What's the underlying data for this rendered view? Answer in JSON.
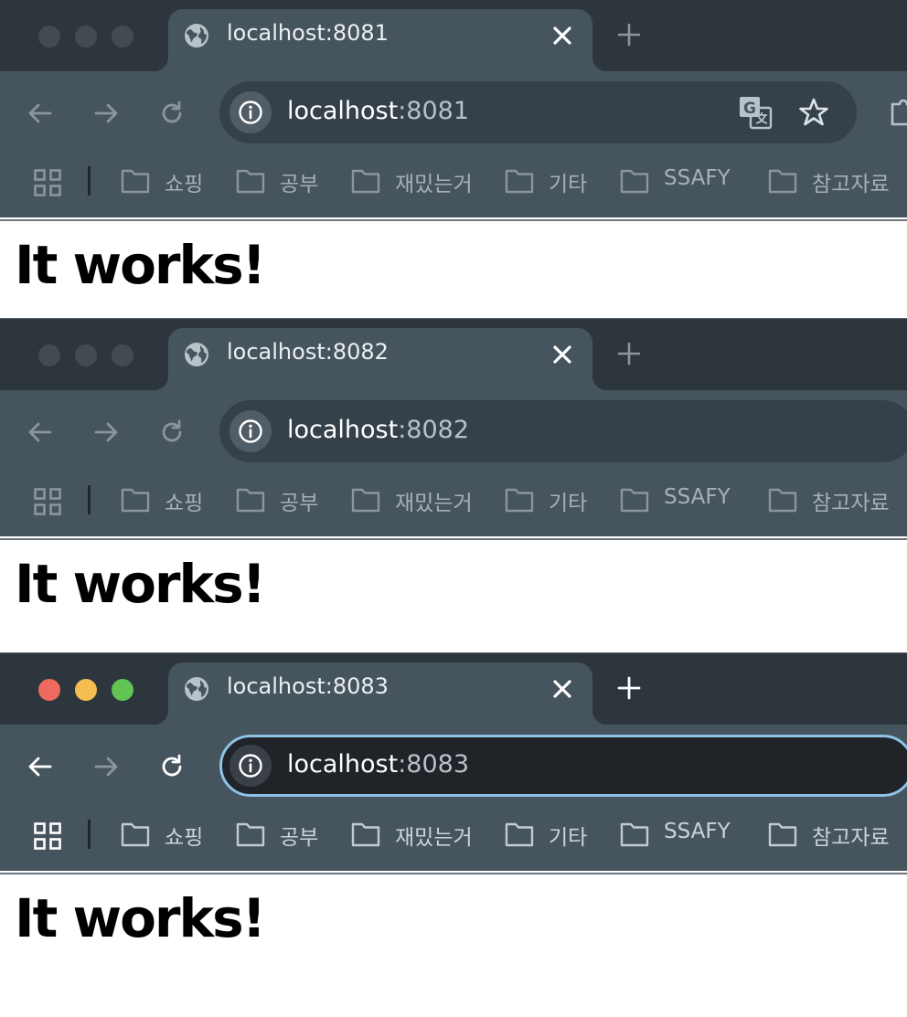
{
  "windows": [
    {
      "state": "inactive",
      "tab_title": "localhost:8081",
      "url_host": "localhost",
      "url_port": ":8081",
      "page_heading": "It works!"
    },
    {
      "state": "inactive",
      "tab_title": "localhost:8082",
      "url_host": "localhost",
      "url_port": ":8082",
      "page_heading": "It works!"
    },
    {
      "state": "active",
      "tab_title": "localhost:8083",
      "url_host": "localhost",
      "url_port": ":8083",
      "page_heading": "It works!"
    }
  ],
  "bookmarks": [
    "쇼핑",
    "공부",
    "재밌는거",
    "기타",
    "SSAFY",
    "참고자료"
  ],
  "colors": {
    "tab_strip": "#2d363d",
    "toolbar": "#46545e",
    "omnibox_inactive": "#35414a",
    "omnibox_focused": "#202328",
    "focus_ring": "#8ec3e6",
    "traffic_red": "#ee6a5f",
    "traffic_yellow": "#f5bd4f",
    "traffic_green": "#61c454"
  },
  "icons": {
    "tab": "globe-icon",
    "close": "close-icon",
    "new_tab": "plus-icon",
    "back": "back-arrow-icon",
    "forward": "forward-arrow-icon",
    "reload": "reload-icon",
    "site_info": "info-icon",
    "translate": "translate-icon",
    "bookmark": "star-icon",
    "extensions": "puzzle-icon",
    "apps": "apps-grid-icon",
    "folder": "folder-icon"
  }
}
